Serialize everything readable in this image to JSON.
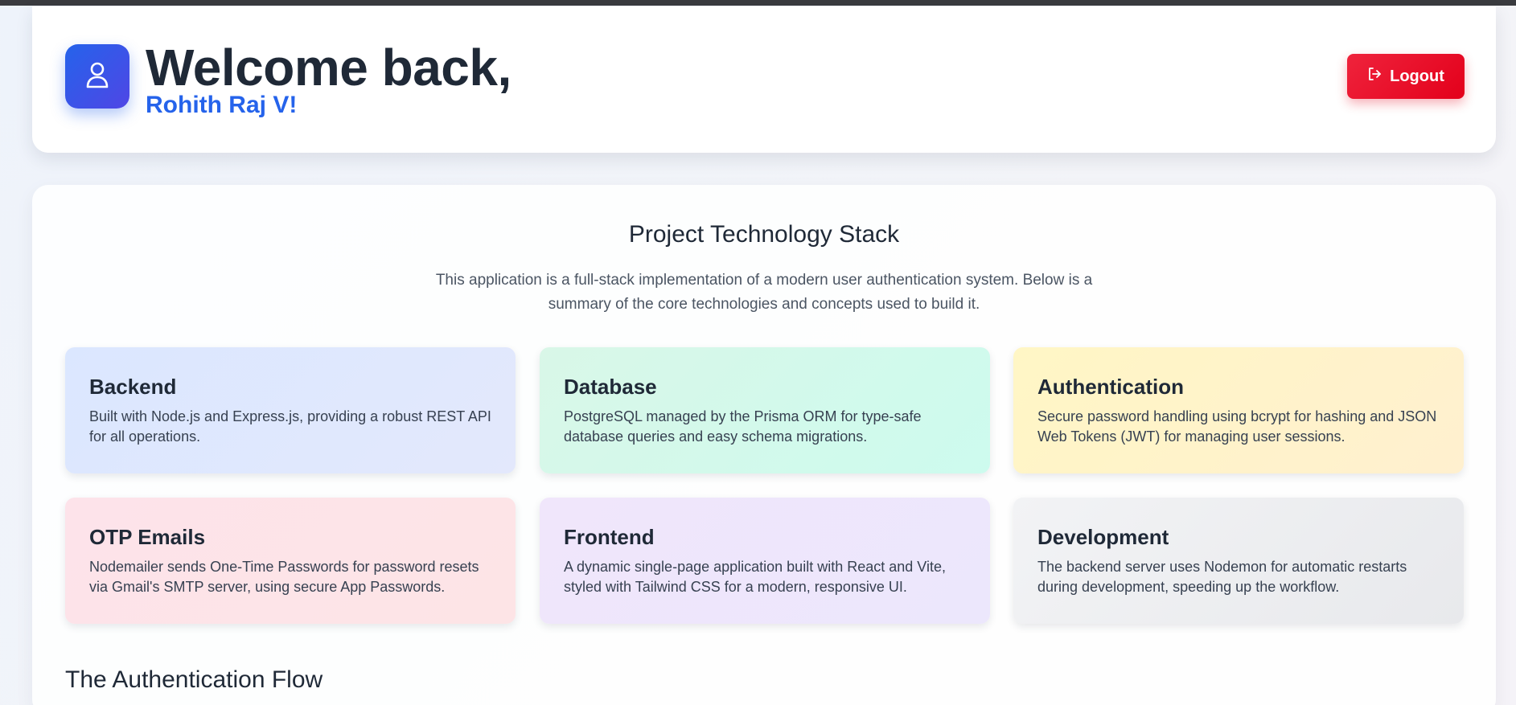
{
  "header": {
    "welcome": "Welcome back,",
    "user_name": "Rohith Raj V!",
    "logout_label": "Logout",
    "avatar_icon": "user-icon",
    "logout_icon": "logout-icon"
  },
  "stack": {
    "title": "Project Technology Stack",
    "description": "This application is a full-stack implementation of a modern user authentication system. Below is a summary of the core technologies and concepts used to build it.",
    "cards": [
      {
        "title": "Backend",
        "text": "Built with Node.js and Express.js, providing a robust REST API for all operations."
      },
      {
        "title": "Database",
        "text": "PostgreSQL managed by the Prisma ORM for type-safe database queries and easy schema migrations."
      },
      {
        "title": "Authentication",
        "text": "Secure password handling using bcrypt for hashing and JSON Web Tokens (JWT) for managing user sessions."
      },
      {
        "title": "OTP Emails",
        "text": "Nodemailer sends One-Time Passwords for password resets via Gmail's SMTP server, using secure App Passwords."
      },
      {
        "title": "Frontend",
        "text": "A dynamic single-page application built with React and Vite, styled with Tailwind CSS for a modern, responsive UI."
      },
      {
        "title": "Development",
        "text": "The backend server uses Nodemon for automatic restarts during development, speeding up the workflow."
      }
    ]
  },
  "flow": {
    "title": "The Authentication Flow"
  },
  "colors": {
    "accent": "#2563eb",
    "logout": "#e3001b",
    "text_dark": "#1f2937"
  }
}
